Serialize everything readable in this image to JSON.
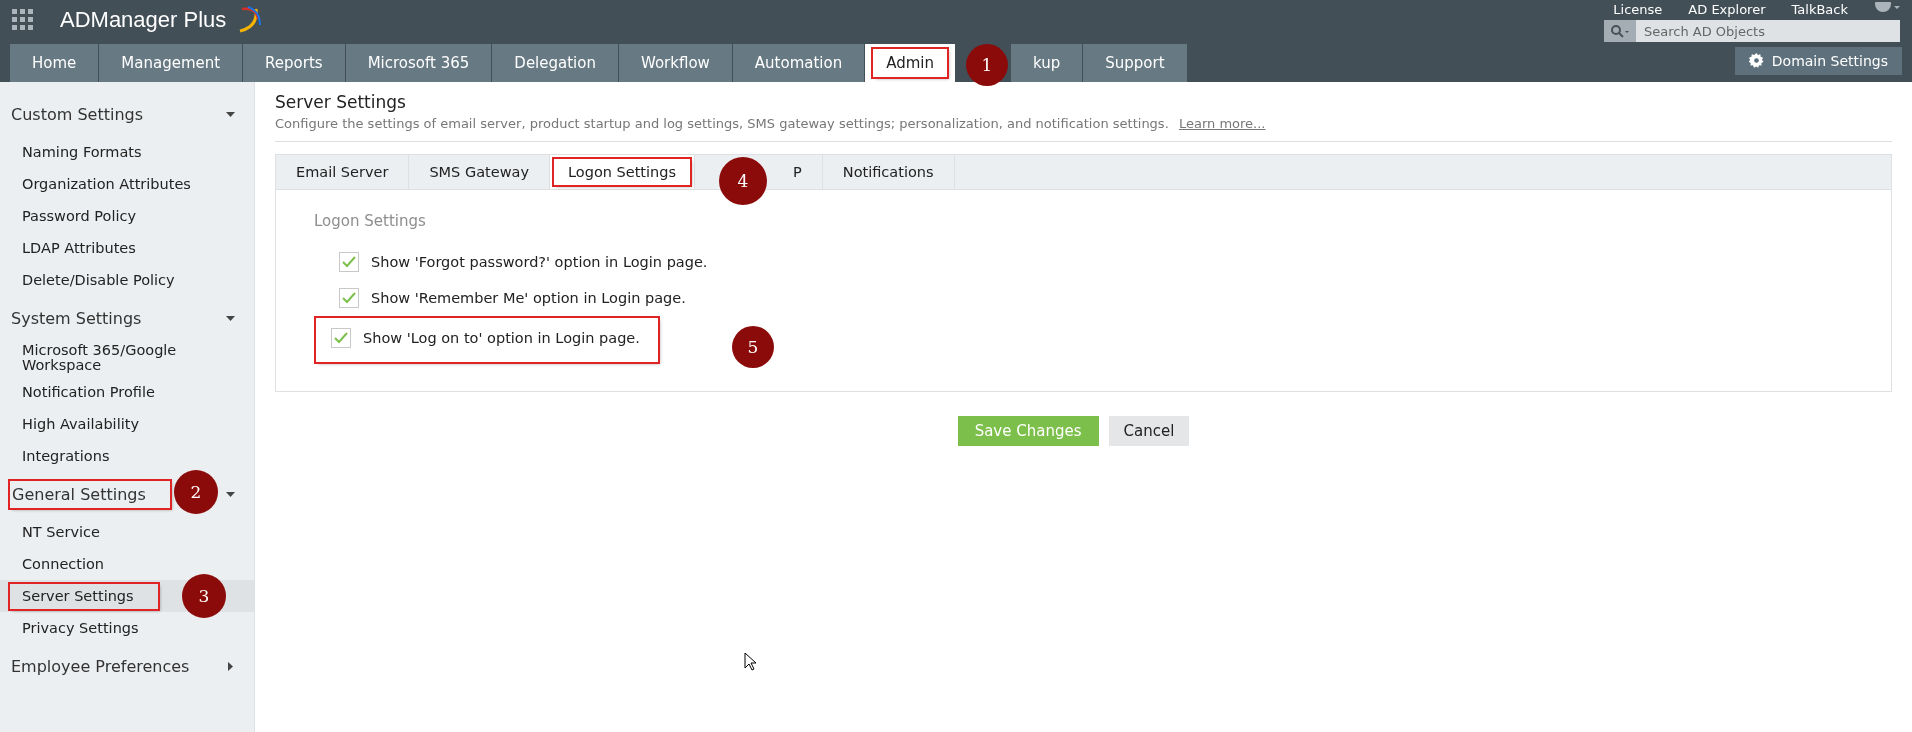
{
  "header": {
    "logo": "ADManager Plus",
    "links": [
      "License",
      "AD Explorer",
      "TalkBack"
    ],
    "search": {
      "placeholder": "Search AD Objects"
    },
    "domain_button": "Domain Settings"
  },
  "nav_tabs": [
    {
      "label": "Home",
      "selected": false
    },
    {
      "label": "Management",
      "selected": false
    },
    {
      "label": "Reports",
      "selected": false
    },
    {
      "label": "Microsoft 365",
      "selected": false
    },
    {
      "label": "Delegation",
      "selected": false
    },
    {
      "label": "Workflow",
      "selected": false
    },
    {
      "label": "Automation",
      "selected": false
    },
    {
      "label": "Admin",
      "selected": true,
      "callout": "1"
    },
    {
      "label": "kup",
      "selected": false
    },
    {
      "label": "Support",
      "selected": false
    }
  ],
  "sidebar": {
    "sections": [
      {
        "title": "Custom Settings",
        "expanded": true,
        "items": [
          {
            "label": "Naming Formats",
            "selected": false
          },
          {
            "label": "Organization Attributes",
            "selected": false
          },
          {
            "label": "Password Policy",
            "selected": false
          },
          {
            "label": "LDAP Attributes",
            "selected": false
          },
          {
            "label": "Delete/Disable Policy",
            "selected": false
          }
        ]
      },
      {
        "title": "System Settings",
        "expanded": true,
        "items": [
          {
            "label": "Microsoft 365/Google Workspace",
            "selected": false
          },
          {
            "label": "Notification Profile",
            "selected": false
          },
          {
            "label": "High Availability",
            "selected": false
          },
          {
            "label": "Integrations",
            "selected": false
          }
        ]
      },
      {
        "title": "General Settings",
        "expanded": true,
        "callout": "2",
        "items": [
          {
            "label": "NT Service",
            "selected": false
          },
          {
            "label": "Connection",
            "selected": false
          },
          {
            "label": "Server Settings",
            "selected": true,
            "callout": "3"
          },
          {
            "label": "Privacy Settings",
            "selected": false
          }
        ]
      },
      {
        "title": "Employee Preferences",
        "expanded": false
      }
    ]
  },
  "page": {
    "title": "Server Settings",
    "description": "Configure the settings of email server, product startup and log settings, SMS gateway settings; personalization, and notification settings.",
    "learn_more": "Learn more...",
    "tabs": [
      {
        "label": "Email Server",
        "selected": false
      },
      {
        "label": "SMS Gateway",
        "selected": false
      },
      {
        "label": "Logon Settings",
        "selected": true,
        "callout": "4"
      },
      {
        "label": "P",
        "selected": false
      },
      {
        "label": "Notifications",
        "selected": false
      }
    ],
    "section_title": "Logon Settings",
    "options": [
      {
        "label": "Show 'Forgot password?' option in Login page.",
        "checked": true
      },
      {
        "label": "Show 'Remember Me' option in Login page.",
        "checked": true
      },
      {
        "label": "Show 'Log on to' option in Login page.",
        "checked": true,
        "callout": "5"
      }
    ],
    "buttons": [
      "Save Changes",
      "Cancel"
    ]
  }
}
